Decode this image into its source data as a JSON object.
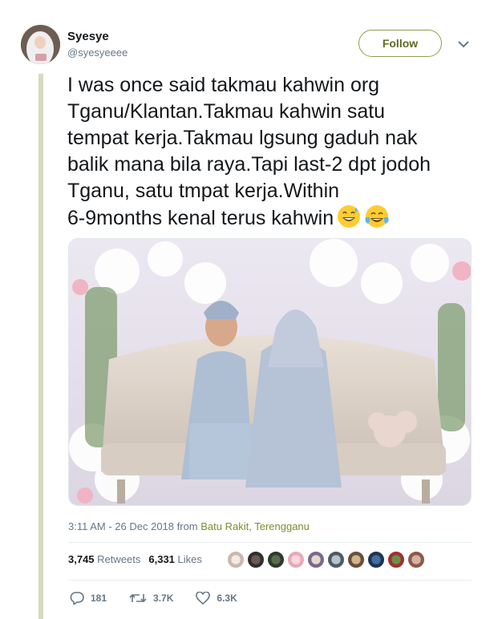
{
  "user": {
    "display_name": "Syesye",
    "handle": "@syesyeeee"
  },
  "follow_label": "Follow",
  "tweet_lines": [
    "I was once said takmau kahwin org",
    "Tganu/Klantan.Takmau kahwin satu",
    "tempat kerja.Takmau lgsung gaduh nak",
    "balik mana bila raya.Tapi last-2 dpt jodoh",
    "Tganu, satu tmpat kerja.Within",
    "6-9months kenal terus kahwin"
  ],
  "emojis": [
    "grinning-sweat-emoji",
    "tears-of-joy-emoji"
  ],
  "timestamp": "3:11 AM - 26 Dec 2018",
  "from_label": "from",
  "location": "Batu Rakit, Terengganu",
  "stats": {
    "retweets_count": "3,745",
    "retweets_label": "Retweets",
    "likes_count": "6,331",
    "likes_label": "Likes"
  },
  "actions": {
    "replies": "181",
    "retweets": "3.7K",
    "likes": "6.3K"
  },
  "colors": {
    "accent": "#7b8c2e",
    "follow_border": "#8f9d4f",
    "muted": "#657786"
  }
}
